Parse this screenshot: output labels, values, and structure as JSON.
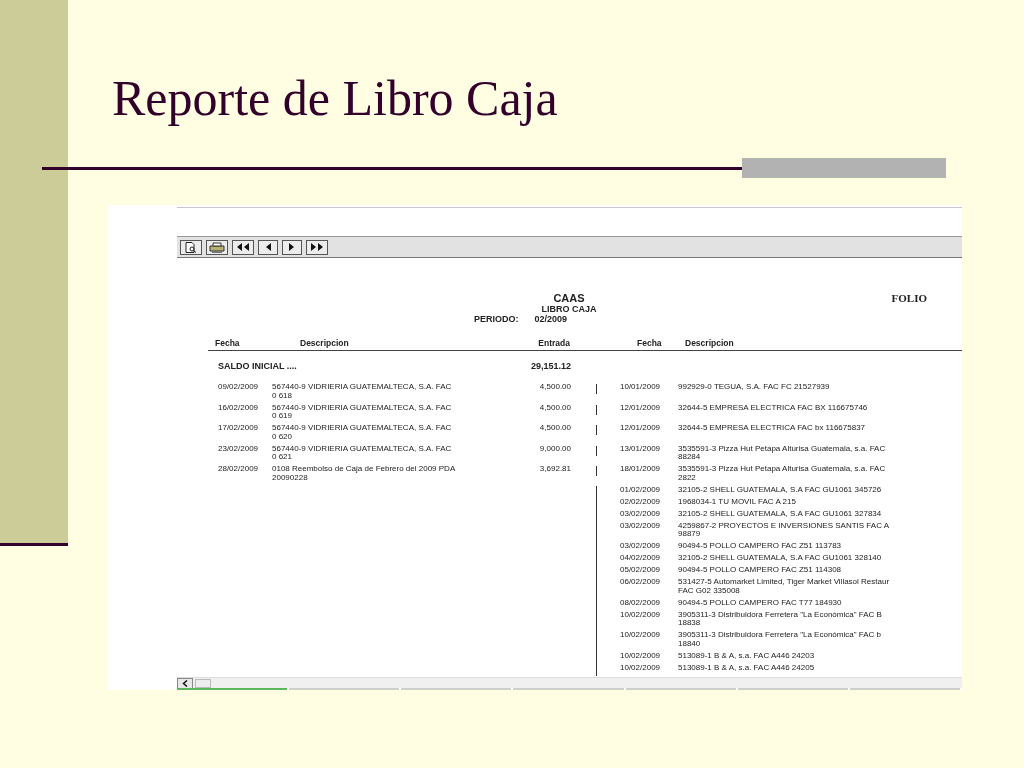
{
  "slide": {
    "title": "Reporte de Libro Caja"
  },
  "viewer": {
    "toolbar": [
      {
        "kind": "preview"
      },
      {
        "kind": "print"
      },
      {
        "kind": "first"
      },
      {
        "kind": "prev"
      },
      {
        "kind": "next"
      },
      {
        "kind": "last"
      }
    ]
  },
  "report": {
    "company": "CAAS",
    "name": "LIBRO CAJA",
    "period_label": "PERIODO:",
    "period": "02/2009",
    "folio": "FOLIO",
    "columns": [
      "Fecha",
      "Descripcion",
      "Entrada",
      "Fecha",
      "Descripcion"
    ],
    "opening": {
      "label": "SALDO INICIAL ....",
      "amount": "29,151.12"
    },
    "rows": [
      {
        "income": {
          "date": "09/02/2009",
          "description": "567440-9 VIDRIERIA GUATEMALTECA, S.A. FAC\n0 618",
          "amount": "4,500.00"
        },
        "expense": {
          "date": "10/01/2009",
          "description": "992929-0 TEGUA, S.A. FAC FC 21527939"
        }
      },
      {
        "income": {
          "date": "16/02/2009",
          "description": "567440-9 VIDRIERIA GUATEMALTECA, S.A. FAC\n0 619",
          "amount": "4,500.00"
        },
        "expense": {
          "date": "12/01/2009",
          "description": "32644-5 EMPRESA ELECTRICA FAC BX 116675746"
        }
      },
      {
        "income": {
          "date": "17/02/2009",
          "description": "567440-9 VIDRIERIA GUATEMALTECA, S.A. FAC\n0 620",
          "amount": "4,500.00"
        },
        "expense": {
          "date": "12/01/2009",
          "description": "32644-5 EMPRESA ELECTRICA FAC bx 116675837"
        }
      },
      {
        "income": {
          "date": "23/02/2009",
          "description": "567440-9 VIDRIERIA GUATEMALTECA, S.A. FAC\n0 621",
          "amount": "9,000.00"
        },
        "expense": {
          "date": "13/01/2009",
          "description": "3535591-3 Pizza Hut Petapa Alturisa Guatemala, s.a. FAC\n88284"
        }
      },
      {
        "income": {
          "date": "28/02/2009",
          "description": "0108 Reembolso de Caja de Febrero del 2009 PDA\n20090228",
          "amount": "3,692.81"
        },
        "expense": {
          "date": "18/01/2009",
          "description": "3535591-3 Pizza Hut Petapa Alturisa Guatemala, s.a. FAC\n2822"
        }
      },
      {
        "expense": {
          "date": "01/02/2009",
          "description": "32105-2 SHELL GUATEMALA, S.A FAC GU1061 345726"
        }
      },
      {
        "expense": {
          "date": "02/02/2009",
          "description": "1968034-1 TU MOVIL FAC A 215"
        }
      },
      {
        "expense": {
          "date": "03/02/2009",
          "description": "32105-2 SHELL GUATEMALA, S.A FAC GU1061 327834"
        }
      },
      {
        "expense": {
          "date": "03/02/2009",
          "description": "4259867-2 PROYECTOS E INVERSIONES SANTIS FAC A\n98879"
        }
      },
      {
        "expense": {
          "date": "03/02/2009",
          "description": "90494-5 POLLO CAMPERO FAC Z51 113783"
        }
      },
      {
        "expense": {
          "date": "04/02/2009",
          "description": "32105-2 SHELL GUATEMALA, S.A FAC GU1061 328140"
        }
      },
      {
        "expense": {
          "date": "05/02/2009",
          "description": "90494-5 POLLO CAMPERO FAC Z51 114308"
        }
      },
      {
        "expense": {
          "date": "06/02/2009",
          "description": "531427-5 Automarket Limited, Tiger Market Villasol Restaur\nFAC G02 335008"
        }
      },
      {
        "expense": {
          "date": "08/02/2009",
          "description": "90494-5 POLLO CAMPERO FAC T77 184930"
        }
      },
      {
        "expense": {
          "date": "10/02/2009",
          "description": "3905311-3 Distribuidora Ferretera \"La Económica\" FAC B\n18838"
        }
      },
      {
        "expense": {
          "date": "10/02/2009",
          "description": "3905311-3 Distribuidora Ferretera \"La Económica\" FAC b\n18840"
        }
      },
      {
        "expense": {
          "date": "10/02/2009",
          "description": "513089-1 B & A, s.a. FAC A446 24203"
        }
      },
      {
        "expense": {
          "date": "10/02/2009",
          "description": "513089-1 B & A, s.a. FAC A446 24205"
        }
      }
    ]
  }
}
